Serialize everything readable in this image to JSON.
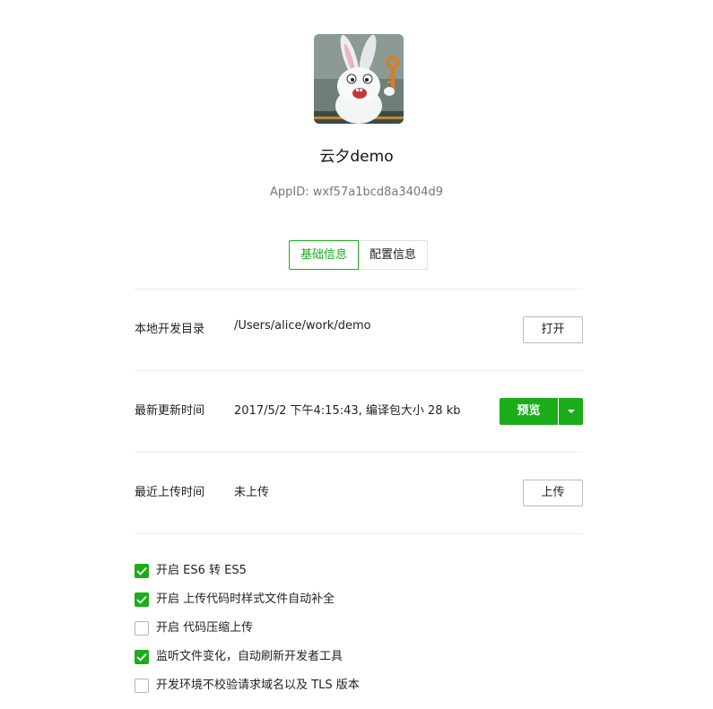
{
  "app": {
    "name": "云夕demo",
    "app_id": "AppID: wxf57a1bcd8a3404d9"
  },
  "tabs": [
    {
      "label": "基础信息",
      "active": true
    },
    {
      "label": "配置信息",
      "active": false
    }
  ],
  "rows": {
    "local_dir": {
      "label": "本地开发目录",
      "value": "/Users/alice/work/demo",
      "button": "打开"
    },
    "last_update": {
      "label": "最新更新时间",
      "value": "2017/5/2 下午4:15:43, 编译包大小 28 kb",
      "button": "预览"
    },
    "last_upload": {
      "label": "最近上传时间",
      "value": "未上传",
      "button": "上传"
    }
  },
  "options": [
    {
      "label": "开启 ES6 转 ES5",
      "checked": true
    },
    {
      "label": "开启 上传代码时样式文件自动补全",
      "checked": true
    },
    {
      "label": "开启 代码压缩上传",
      "checked": false
    },
    {
      "label": "监听文件变化，自动刷新开发者工具",
      "checked": true
    },
    {
      "label": "开发环境不校验请求域名以及 TLS 版本",
      "checked": false
    }
  ],
  "colors": {
    "accent": "#1aad19"
  }
}
